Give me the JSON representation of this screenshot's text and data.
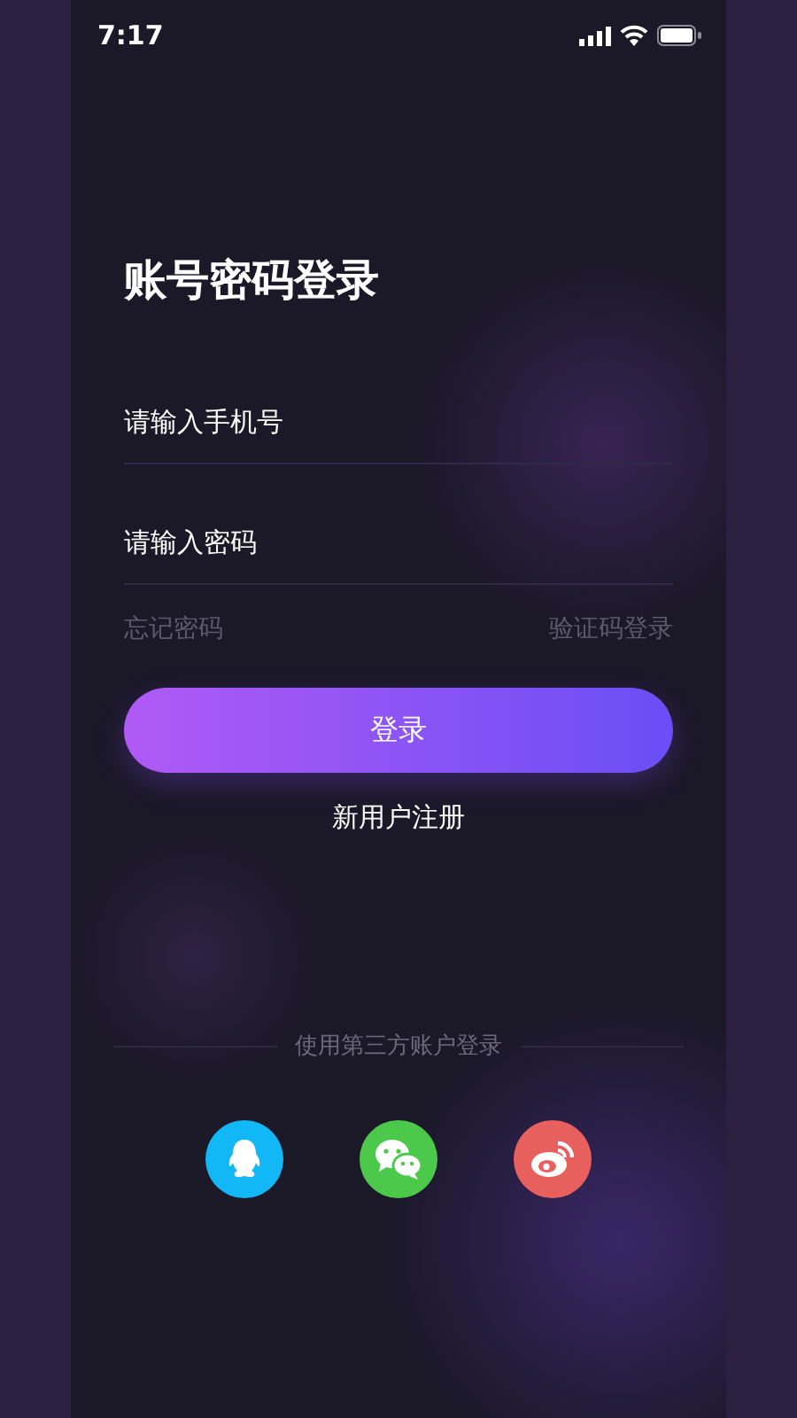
{
  "status_bar": {
    "time": "7:17"
  },
  "title": "账号密码登录",
  "fields": [
    {
      "placeholder": "请输入手机号"
    },
    {
      "placeholder": "请输入密码"
    }
  ],
  "links": [
    "忘记密码",
    "验证码登录"
  ],
  "login_button": "登录",
  "register_link": "新用户注册",
  "third_party": {
    "label": "使用第三方账户登录",
    "providers": [
      {
        "kind": "qq",
        "color": "#12b7f5"
      },
      {
        "kind": "wechat",
        "color": "#4cc94a"
      },
      {
        "kind": "weibo",
        "color": "#e8605d"
      }
    ]
  }
}
